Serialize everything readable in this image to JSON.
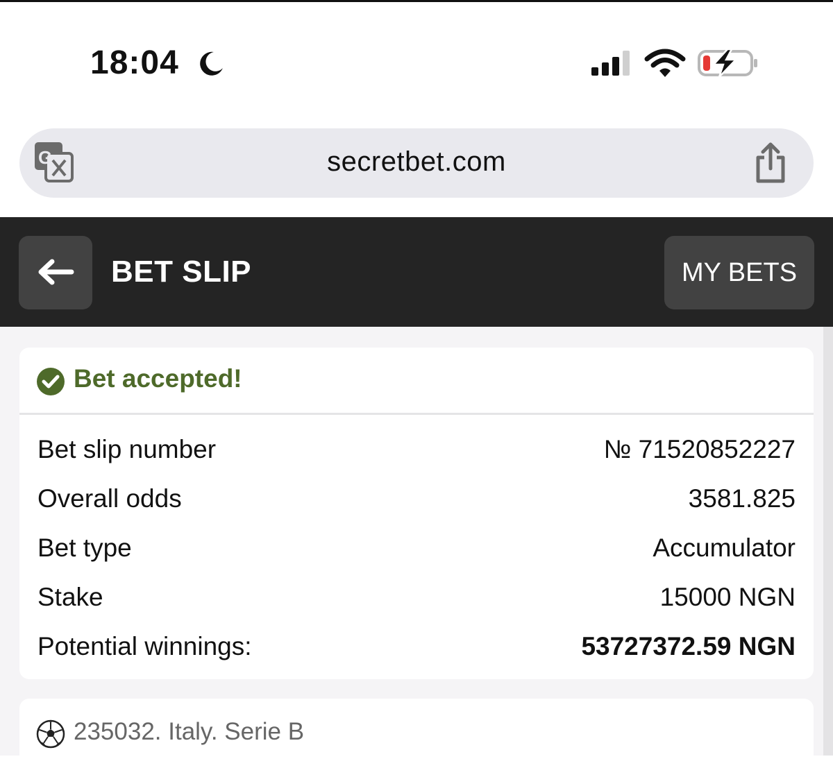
{
  "status_bar": {
    "time": "18:04",
    "icons": [
      "moon-icon",
      "signal-icon",
      "wifi-icon",
      "battery-charging-icon"
    ],
    "battery_color": "#e53935"
  },
  "browser": {
    "url": "secretbet.com",
    "icons": [
      "translate-icon",
      "share-icon"
    ]
  },
  "header": {
    "title": "BET SLIP",
    "my_bets_label": "MY BETS",
    "back_icon": "arrow-left-icon",
    "background": "#242424"
  },
  "bet": {
    "status_text": "Bet accepted!",
    "status_color": "#4e6a2a",
    "rows": [
      {
        "label": "Bet slip number",
        "value": "№ 71520852227"
      },
      {
        "label": "Overall odds",
        "value": "3581.825"
      },
      {
        "label": "Bet type",
        "value": "Accumulator"
      },
      {
        "label": "Stake",
        "value": "15000 NGN"
      },
      {
        "label": "Potential winnings:",
        "value": "53727372.59 NGN"
      }
    ]
  },
  "events": [
    {
      "icon": "soccer-ball-icon",
      "title": "235032. Italy. Serie B"
    }
  ]
}
